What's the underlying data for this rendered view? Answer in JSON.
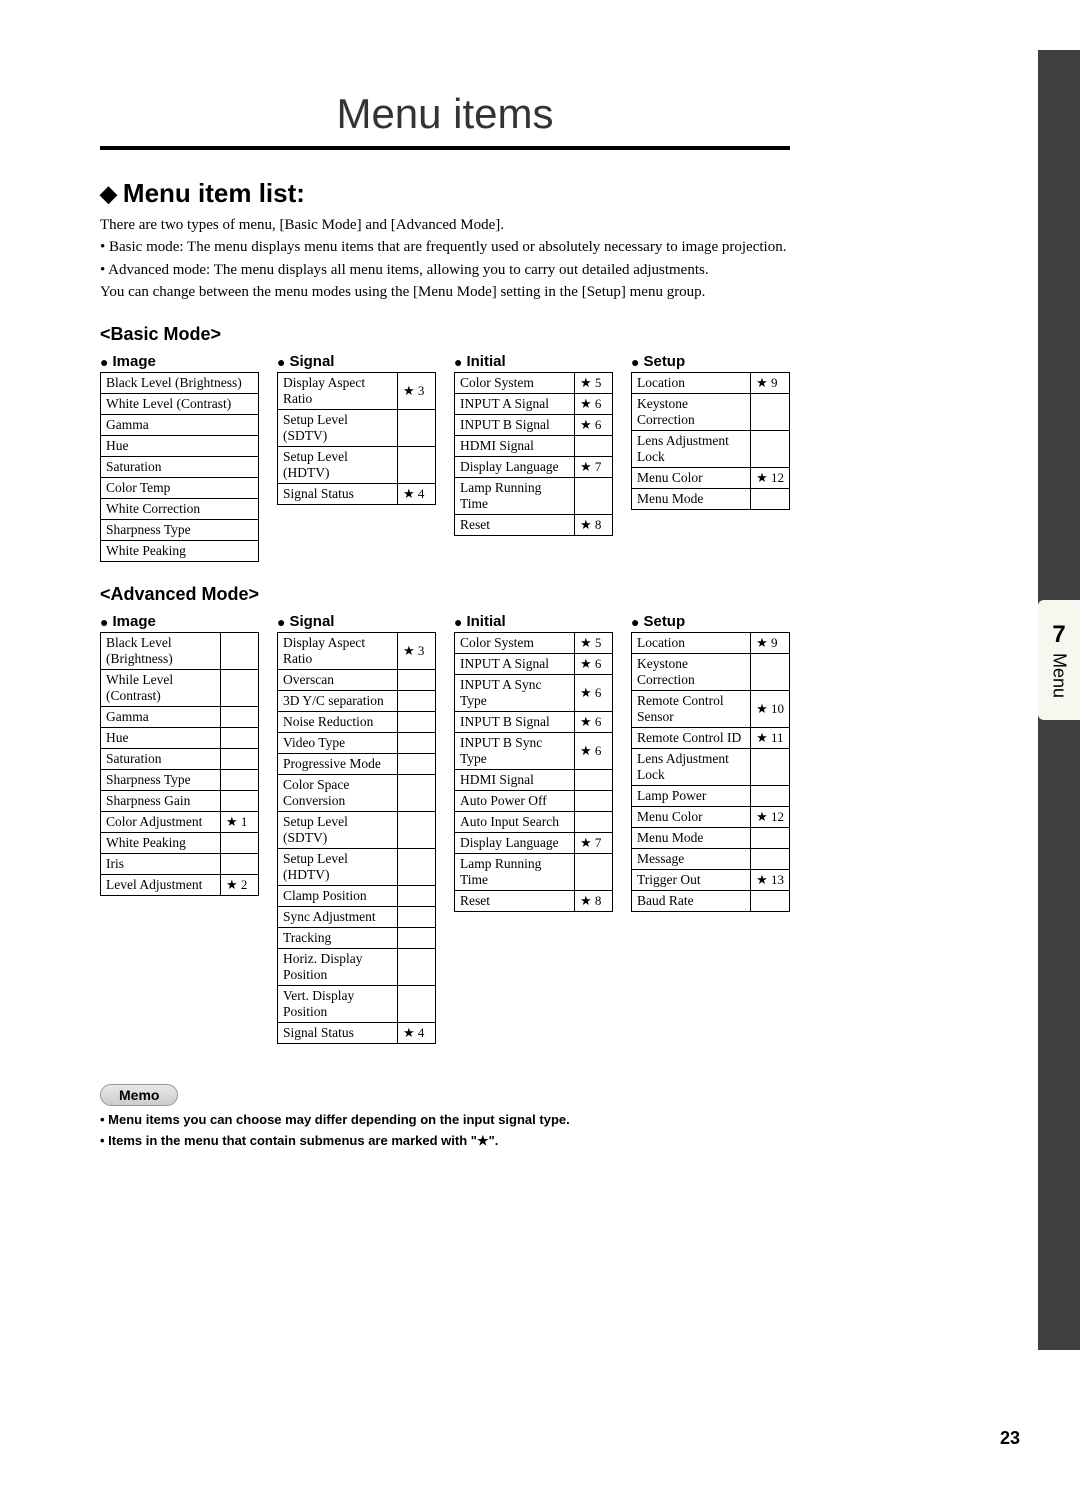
{
  "page_title": "Menu items",
  "section_title": "Menu item list:",
  "intro": {
    "line1": "There are two types of menu, [Basic Mode] and [Advanced Mode].",
    "line2": "• Basic mode: The menu displays menu items that are frequently used or absolutely necessary to image projection.",
    "line3": "• Advanced mode: The menu displays all menu items, allowing you to carry out detailed adjustments.",
    "line4": "You can change between the menu modes using the [Menu Mode] setting in the [Setup] menu group."
  },
  "basic_mode_title": "<Basic Mode>",
  "advanced_mode_title": "<Advanced Mode>",
  "col_headers": {
    "image": "Image",
    "signal": "Signal",
    "initial": "Initial",
    "setup": "Setup"
  },
  "basic": {
    "image": [
      {
        "label": "Black Level (Brightness)"
      },
      {
        "label": "White Level (Contrast)"
      },
      {
        "label": "Gamma"
      },
      {
        "label": "Hue"
      },
      {
        "label": "Saturation"
      },
      {
        "label": "Color Temp"
      },
      {
        "label": "White Correction"
      },
      {
        "label": "Sharpness Type"
      },
      {
        "label": "White Peaking"
      }
    ],
    "signal": [
      {
        "label": "Display Aspect Ratio",
        "note": "3"
      },
      {
        "label": "Setup Level (SDTV)"
      },
      {
        "label": "Setup Level (HDTV)"
      },
      {
        "label": "Signal Status",
        "note": "4"
      }
    ],
    "initial": [
      {
        "label": "Color System",
        "note": "5"
      },
      {
        "label": "INPUT A Signal",
        "note": "6"
      },
      {
        "label": "INPUT B Signal",
        "note": "6"
      },
      {
        "label": "HDMI Signal"
      },
      {
        "label": "Display Language",
        "note": "7"
      },
      {
        "label": "Lamp Running Time"
      },
      {
        "label": "Reset",
        "note": "8"
      }
    ],
    "setup": [
      {
        "label": "Location",
        "note": "9"
      },
      {
        "label": "Keystone Correction"
      },
      {
        "label": "Lens Adjustment Lock"
      },
      {
        "label": "Menu Color",
        "note": "12"
      },
      {
        "label": "Menu Mode"
      }
    ]
  },
  "advanced": {
    "image": [
      {
        "label": "Black Level (Brightness)"
      },
      {
        "label": "While Level (Contrast)"
      },
      {
        "label": "Gamma"
      },
      {
        "label": "Hue"
      },
      {
        "label": "Saturation"
      },
      {
        "label": "Sharpness Type"
      },
      {
        "label": "Sharpness Gain"
      },
      {
        "label": "Color Adjustment",
        "note": "1"
      },
      {
        "label": "White Peaking"
      },
      {
        "label": "Iris"
      },
      {
        "label": "Level Adjustment",
        "note": "2"
      }
    ],
    "signal": [
      {
        "label": "Display Aspect Ratio",
        "note": "3"
      },
      {
        "label": "Overscan"
      },
      {
        "label": "3D Y/C separation"
      },
      {
        "label": "Noise Reduction"
      },
      {
        "label": "Video Type"
      },
      {
        "label": "Progressive Mode"
      },
      {
        "label": "Color Space Conversion"
      },
      {
        "label": "Setup Level (SDTV)"
      },
      {
        "label": "Setup Level (HDTV)"
      },
      {
        "label": "Clamp Position"
      },
      {
        "label": "Sync Adjustment"
      },
      {
        "label": "Tracking"
      },
      {
        "label": "Horiz. Display Position"
      },
      {
        "label": "Vert. Display Position"
      },
      {
        "label": "Signal Status",
        "note": "4"
      }
    ],
    "initial": [
      {
        "label": "Color System",
        "note": "5"
      },
      {
        "label": "INPUT A Signal",
        "note": "6"
      },
      {
        "label": "INPUT A Sync Type",
        "note": "6"
      },
      {
        "label": "INPUT B Signal",
        "note": "6"
      },
      {
        "label": "INPUT B Sync Type",
        "note": "6"
      },
      {
        "label": "HDMI Signal"
      },
      {
        "label": "Auto Power Off"
      },
      {
        "label": "Auto Input Search"
      },
      {
        "label": "Display Language",
        "note": "7"
      },
      {
        "label": "Lamp Running Time"
      },
      {
        "label": "Reset",
        "note": "8"
      }
    ],
    "setup": [
      {
        "label": "Location",
        "note": "9"
      },
      {
        "label": "Keystone Correction"
      },
      {
        "label": "Remote Control Sensor",
        "note": "10"
      },
      {
        "label": "Remote Control ID",
        "note": "11"
      },
      {
        "label": "Lens Adjustment Lock"
      },
      {
        "label": "Lamp Power"
      },
      {
        "label": "Menu Color",
        "note": "12"
      },
      {
        "label": "Menu Mode"
      },
      {
        "label": "Message"
      },
      {
        "label": "Trigger Out",
        "note": "13"
      },
      {
        "label": "Baud Rate"
      }
    ]
  },
  "memo_label": "Memo",
  "memo": {
    "line1": "• Menu items you can choose may differ depending on the input signal type.",
    "line2": "• Items in the menu that contain submenus are marked with \"★\"."
  },
  "side_tab": {
    "number": "7",
    "label": "Menu"
  },
  "page_number": "23"
}
